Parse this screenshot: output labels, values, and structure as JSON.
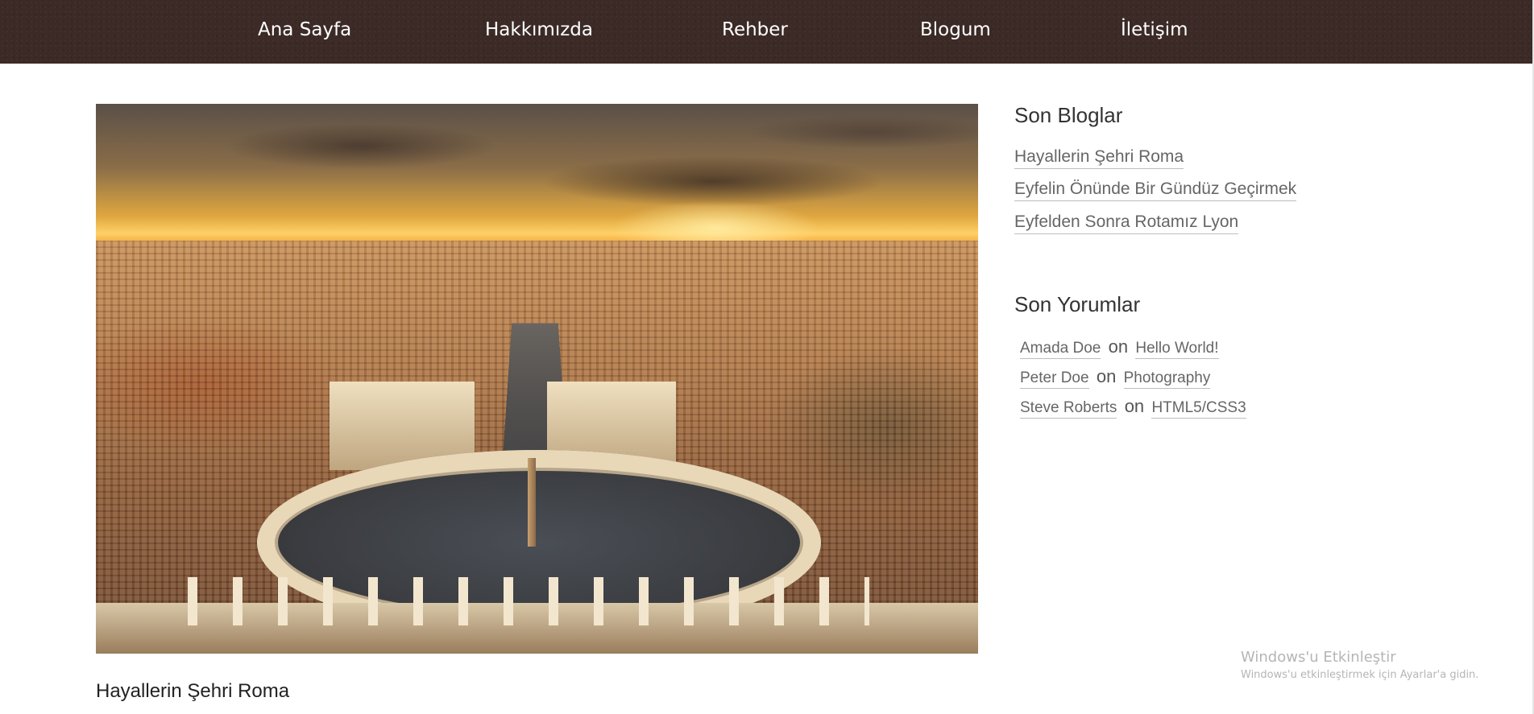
{
  "nav": {
    "items": [
      {
        "label": "Ana Sayfa"
      },
      {
        "label": "Hakkımızda"
      },
      {
        "label": "Rehber"
      },
      {
        "label": "Blogum"
      },
      {
        "label": "İletişim"
      }
    ]
  },
  "post": {
    "title": "Hayallerin Şehri Roma"
  },
  "sidebar": {
    "recent_blogs": {
      "title": "Son Bloglar",
      "items": [
        {
          "label": "Hayallerin Şehri Roma"
        },
        {
          "label": "Eyfelin Önünde Bir Gündüz Geçirmek"
        },
        {
          "label": "Eyfelden Sonra Rotamız Lyon"
        }
      ]
    },
    "recent_comments": {
      "title": "Son Yorumlar",
      "items": [
        {
          "author": "Amada Doe",
          "on": "on",
          "post": "Hello World!"
        },
        {
          "author": "Peter Doe",
          "on": "on",
          "post": "Photography"
        },
        {
          "author": "Steve Roberts",
          "on": "on",
          "post": "HTML5/CSS3"
        }
      ]
    }
  },
  "watermark": {
    "line1": "Windows'u Etkinleştir",
    "line2": "Windows'u etkinleştirmek için Ayarlar'a gidin."
  },
  "colors": {
    "navbar": "#3b2a26",
    "link": "#666666"
  }
}
